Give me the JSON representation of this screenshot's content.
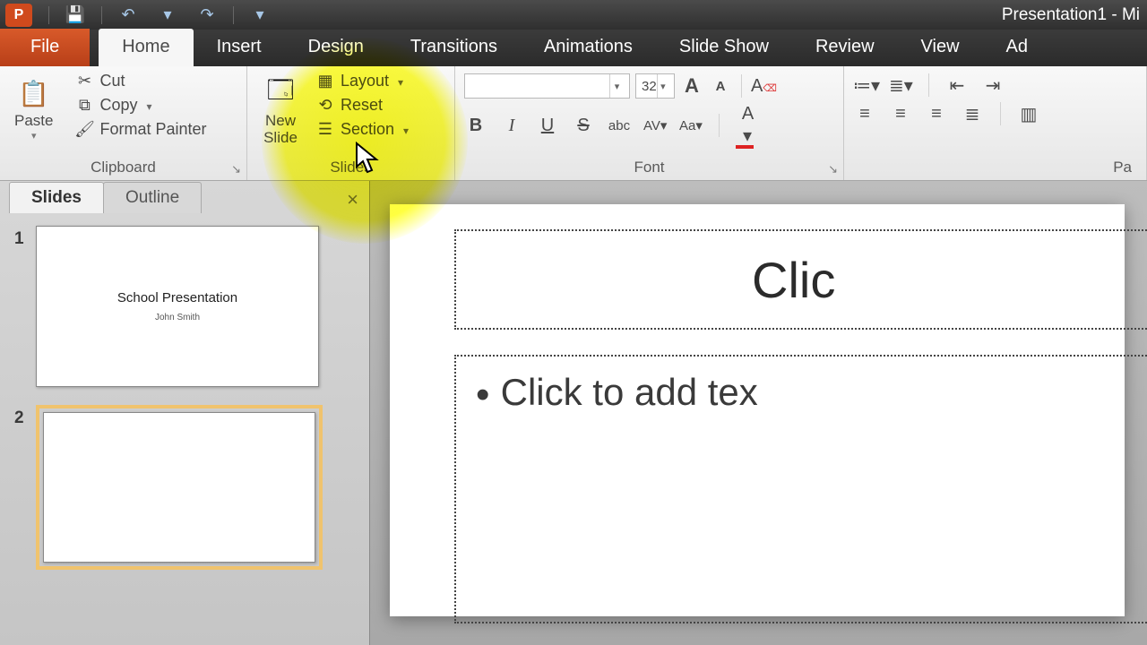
{
  "titlebar": {
    "app_initial": "P",
    "document_title": "Presentation1 - Mi"
  },
  "qat": {
    "save": "💾",
    "undo": "↶",
    "redo": "↷"
  },
  "tabs": {
    "file": "File",
    "home": "Home",
    "insert": "Insert",
    "design": "Design",
    "transitions": "Transitions",
    "animations": "Animations",
    "slideshow": "Slide Show",
    "review": "Review",
    "view": "View",
    "addins": "Ad"
  },
  "ribbon": {
    "clipboard": {
      "paste": "Paste",
      "cut": "Cut",
      "copy": "Copy",
      "format_painter": "Format Painter",
      "label": "Clipboard"
    },
    "slides": {
      "new_slide": "New\nSlide",
      "layout": "Layout",
      "reset": "Reset",
      "section": "Section",
      "label": "Slides"
    },
    "font": {
      "label": "Font",
      "size": "32",
      "grow": "A",
      "shrink": "A",
      "clear": "?",
      "bold": "B",
      "italic": "I",
      "underline": "U",
      "strike": "S",
      "shadow": "abc",
      "spacing": "AV",
      "case": "Aa",
      "color": "A"
    },
    "paragraph": {
      "label": "Pa"
    }
  },
  "panel": {
    "slides_tab": "Slides",
    "outline_tab": "Outline",
    "thumbs": [
      {
        "n": "1",
        "title": "School Presentation",
        "sub": "John Smith"
      },
      {
        "n": "2",
        "title": "",
        "sub": ""
      }
    ]
  },
  "slide": {
    "title_placeholder": "Clic",
    "body_placeholder": "Click to add tex"
  }
}
